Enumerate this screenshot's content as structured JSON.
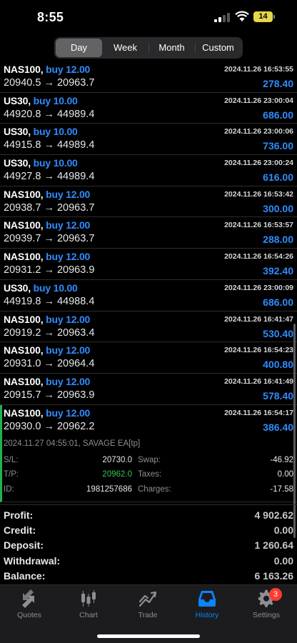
{
  "status": {
    "time": "8:55",
    "battery": "14"
  },
  "periods": [
    "Day",
    "Week",
    "Month",
    "Custom"
  ],
  "active_period": "Day",
  "trades": [
    {
      "symbol": "NAS100,",
      "side": "buy 12.00",
      "prices": "20940.5 → 20963.7",
      "datetime": "2024.11.26 16:53:55",
      "profit": "278.40"
    },
    {
      "symbol": "US30,",
      "side": "buy 10.00",
      "prices": "44920.8 → 44989.4",
      "datetime": "2024.11.26 23:00:04",
      "profit": "686.00"
    },
    {
      "symbol": "US30,",
      "side": "buy 10.00",
      "prices": "44915.8 → 44989.4",
      "datetime": "2024.11.26 23:00:06",
      "profit": "736.00"
    },
    {
      "symbol": "US30,",
      "side": "buy 10.00",
      "prices": "44927.8 → 44989.4",
      "datetime": "2024.11.26 23:00:24",
      "profit": "616.00"
    },
    {
      "symbol": "NAS100,",
      "side": "buy 12.00",
      "prices": "20938.7 → 20963.7",
      "datetime": "2024.11.26 16:53:42",
      "profit": "300.00"
    },
    {
      "symbol": "NAS100,",
      "side": "buy 12.00",
      "prices": "20939.7 → 20963.7",
      "datetime": "2024.11.26 16:53:57",
      "profit": "288.00"
    },
    {
      "symbol": "NAS100,",
      "side": "buy 12.00",
      "prices": "20931.2 → 20963.9",
      "datetime": "2024.11.26 16:54:26",
      "profit": "392.40"
    },
    {
      "symbol": "US30,",
      "side": "buy 10.00",
      "prices": "44919.8 → 44988.4",
      "datetime": "2024.11.26 23:00:09",
      "profit": "686.00"
    },
    {
      "symbol": "NAS100,",
      "side": "buy 12.00",
      "prices": "20919.2 → 20963.4",
      "datetime": "2024.11.26 16:41:47",
      "profit": "530.40"
    },
    {
      "symbol": "NAS100,",
      "side": "buy 12.00",
      "prices": "20931.0 → 20964.4",
      "datetime": "2024.11.26 16:54:23",
      "profit": "400.80"
    },
    {
      "symbol": "NAS100,",
      "side": "buy 12.00",
      "prices": "20915.7 → 20963.9",
      "datetime": "2024.11.26 16:41:49",
      "profit": "578.40"
    }
  ],
  "expanded_trade": {
    "symbol": "NAS100,",
    "side": "buy 12.00",
    "prices": "20930.0 → 20962.2",
    "datetime": "2024.11.26 16:54:17",
    "profit": "386.40",
    "meta": "2024.11.27 04:55:01, SAVAGE EA[tp]",
    "sl_label": "S/L:",
    "sl": "20730.0",
    "tp_label": "T/P:",
    "tp": "20962.0",
    "id_label": "ID:",
    "id": "1981257686",
    "swap_label": "Swap:",
    "swap": "-46.92",
    "taxes_label": "Taxes:",
    "taxes": "0.00",
    "charges_label": "Charges:",
    "charges": "-17.58"
  },
  "summary": [
    {
      "label": "Profit:",
      "value": "4 902.62"
    },
    {
      "label": "Credit:",
      "value": "0.00"
    },
    {
      "label": "Deposit:",
      "value": "1 260.64"
    },
    {
      "label": "Withdrawal:",
      "value": "0.00"
    },
    {
      "label": "Balance:",
      "value": "6 163.26"
    }
  ],
  "tabs": [
    {
      "label": "Quotes",
      "icon": "quotes-icon"
    },
    {
      "label": "Chart",
      "icon": "chart-icon"
    },
    {
      "label": "Trade",
      "icon": "trade-icon"
    },
    {
      "label": "History",
      "icon": "history-icon"
    },
    {
      "label": "Settings",
      "icon": "settings-icon"
    }
  ],
  "active_tab": "History",
  "settings_badge": "3",
  "colors": {
    "accent": "#2f8cff",
    "tab_active": "#0a84ff",
    "positive": "#34c759",
    "badge": "#ff3b30"
  }
}
